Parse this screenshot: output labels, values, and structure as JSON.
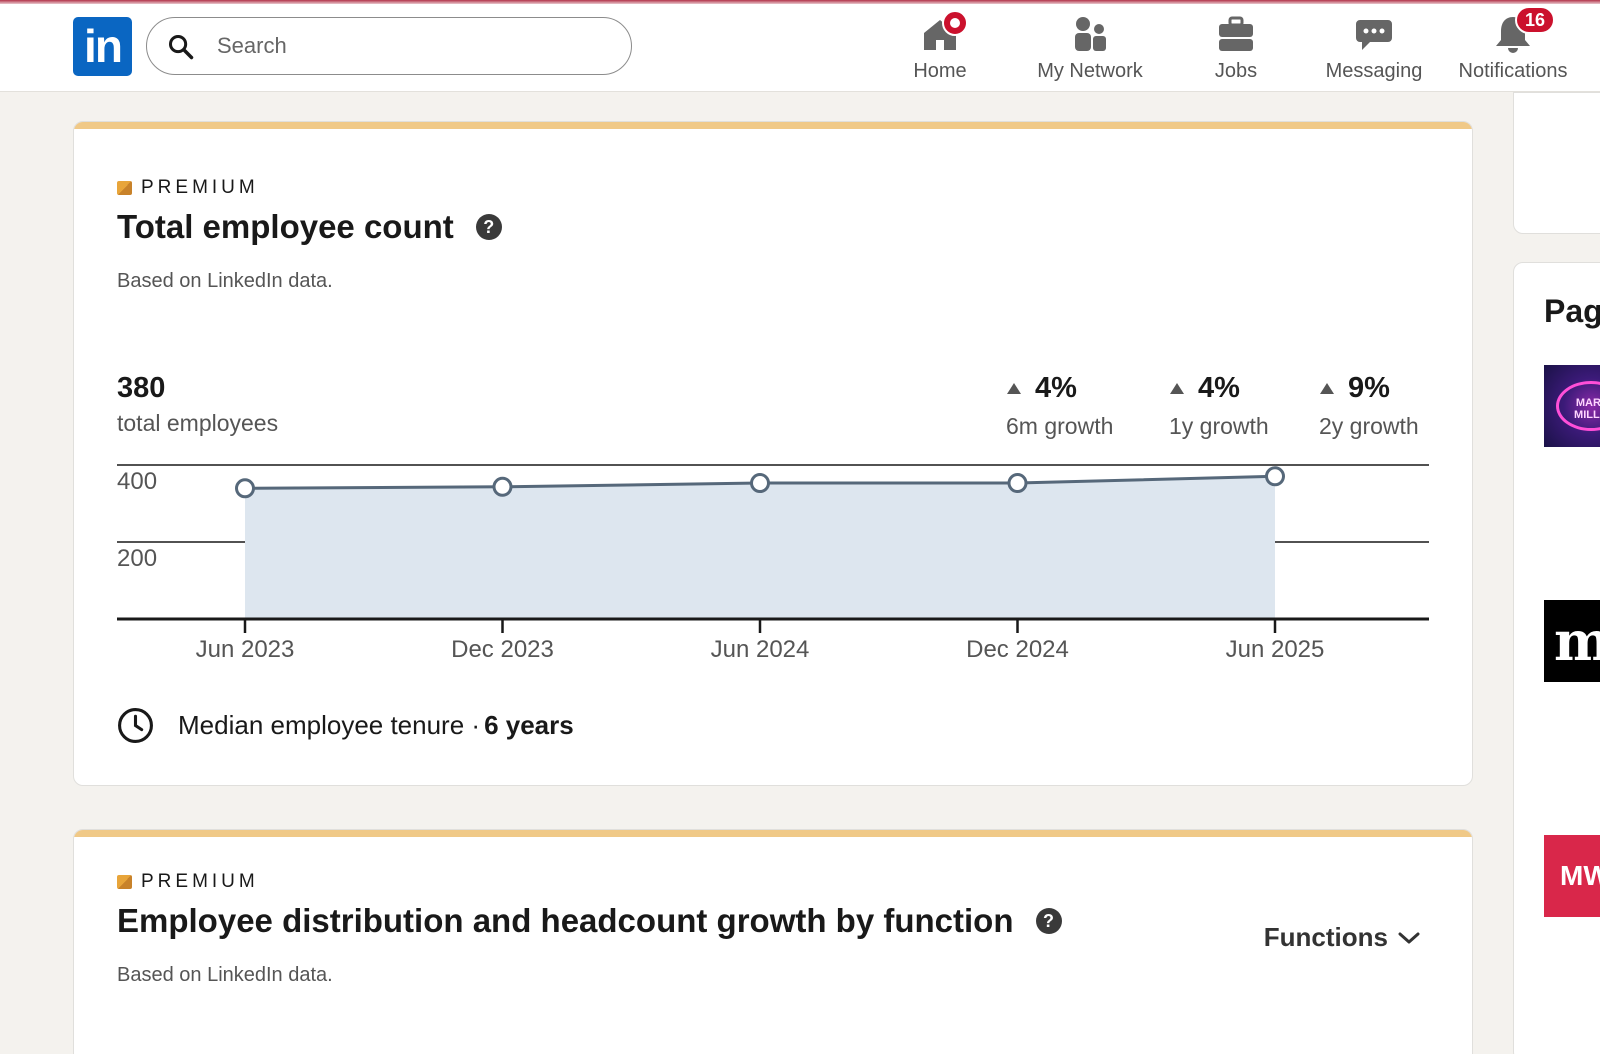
{
  "header": {
    "logo_text": "in",
    "search_placeholder": "Search",
    "nav": {
      "home": "Home",
      "network": "My Network",
      "jobs": "Jobs",
      "messaging": "Messaging",
      "notifications": "Notifications",
      "notifications_badge": "16"
    }
  },
  "card1": {
    "premium_label": "PREMIUM",
    "title": "Total employee count",
    "subtitle": "Based on LinkedIn data.",
    "total_value": "380",
    "total_label": "total employees",
    "growth": [
      {
        "value": "4%",
        "label": "6m growth"
      },
      {
        "value": "4%",
        "label": "1y growth"
      },
      {
        "value": "9%",
        "label": "2y growth"
      }
    ],
    "tenure_label": "Median employee tenure ·",
    "tenure_value": "6 years"
  },
  "chart_data": {
    "type": "area",
    "title": "",
    "xlabel": "",
    "ylabel": "",
    "x": [
      "Jun 2023",
      "Dec 2023",
      "Jun 2024",
      "Dec 2024",
      "Jun 2025"
    ],
    "y_ticks": [
      "400",
      "200"
    ],
    "ylim": [
      0,
      410
    ],
    "series": [
      {
        "values": [
          348,
          352,
          362,
          362,
          380
        ]
      }
    ],
    "grid": true,
    "colors": {
      "line": "#56687a",
      "fill": "#dde6ef",
      "marker_fill": "#ffffff"
    }
  },
  "card2": {
    "premium_label": "PREMIUM",
    "title": "Employee distribution and headcount growth by function",
    "subtitle": "Based on LinkedIn data.",
    "functions_label": "Functions"
  },
  "sidebar": {
    "title": "Pag",
    "thumb1_text": "THE MARKETI MILLENNI",
    "thumb2_text": "mi",
    "thumb3_text": "MW"
  },
  "colors": {
    "brand": "#0a66c2",
    "badge": "#cb112d",
    "premium_accent": "#f0c987"
  }
}
